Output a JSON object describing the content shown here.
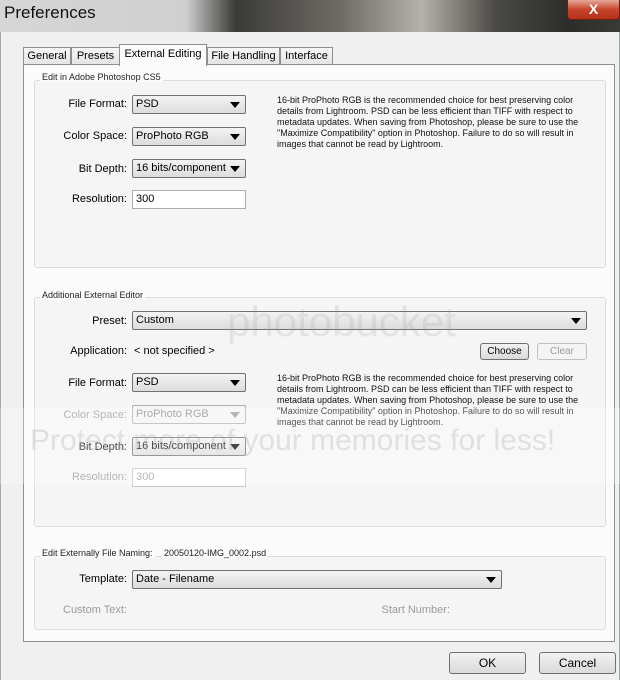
{
  "window": {
    "title": "Preferences",
    "close_label": "X"
  },
  "tabs": [
    {
      "label": "General",
      "active": false
    },
    {
      "label": "Presets",
      "active": false
    },
    {
      "label": "External Editing",
      "active": true
    },
    {
      "label": "File Handling",
      "active": false
    },
    {
      "label": "Interface",
      "active": false
    }
  ],
  "photoshop_group": {
    "title": "Edit in Adobe Photoshop CS5",
    "file_format_label": "File Format:",
    "file_format_value": "PSD",
    "color_space_label": "Color Space:",
    "color_space_value": "ProPhoto RGB",
    "bit_depth_label": "Bit Depth:",
    "bit_depth_value": "16 bits/component",
    "resolution_label": "Resolution:",
    "resolution_value": "300",
    "description": "16-bit ProPhoto RGB is the recommended choice for best preserving color details from Lightroom. PSD can be less efficient than TIFF with respect to metadata updates. When saving from Photoshop, please be sure to use the \"Maximize Compatibility\" option in Photoshop. Failure to do so will result in images that cannot be read by Lightroom."
  },
  "additional_group": {
    "title": "Additional External Editor",
    "preset_label": "Preset:",
    "preset_value": "Custom",
    "application_label": "Application:",
    "application_value": "< not specified >",
    "choose_label": "Choose",
    "clear_label": "Clear",
    "file_format_label": "File Format:",
    "file_format_value": "PSD",
    "color_space_label": "Color Space:",
    "color_space_value": "ProPhoto RGB",
    "bit_depth_label": "Bit Depth:",
    "bit_depth_value": "16 bits/component",
    "resolution_label": "Resolution:",
    "resolution_value": "300",
    "description": "16-bit ProPhoto RGB is the recommended choice for best preserving color details from Lightroom. PSD can be less efficient than TIFF with respect to metadata updates. When saving from Photoshop, please be sure to use the \"Maximize Compatibility\" option in Photoshop. Failure to do so will result in images that cannot be read by Lightroom."
  },
  "naming_group": {
    "title": "Edit Externally File Naming:",
    "example": "20050120-IMG_0002.psd",
    "template_label": "Template:",
    "template_value": "Date - Filename",
    "custom_text_label": "Custom Text:",
    "start_number_label": "Start Number:"
  },
  "footer": {
    "ok_label": "OK",
    "cancel_label": "Cancel"
  },
  "watermark": {
    "logo": "photobucket",
    "text": "Protect more of your memories for less!"
  }
}
